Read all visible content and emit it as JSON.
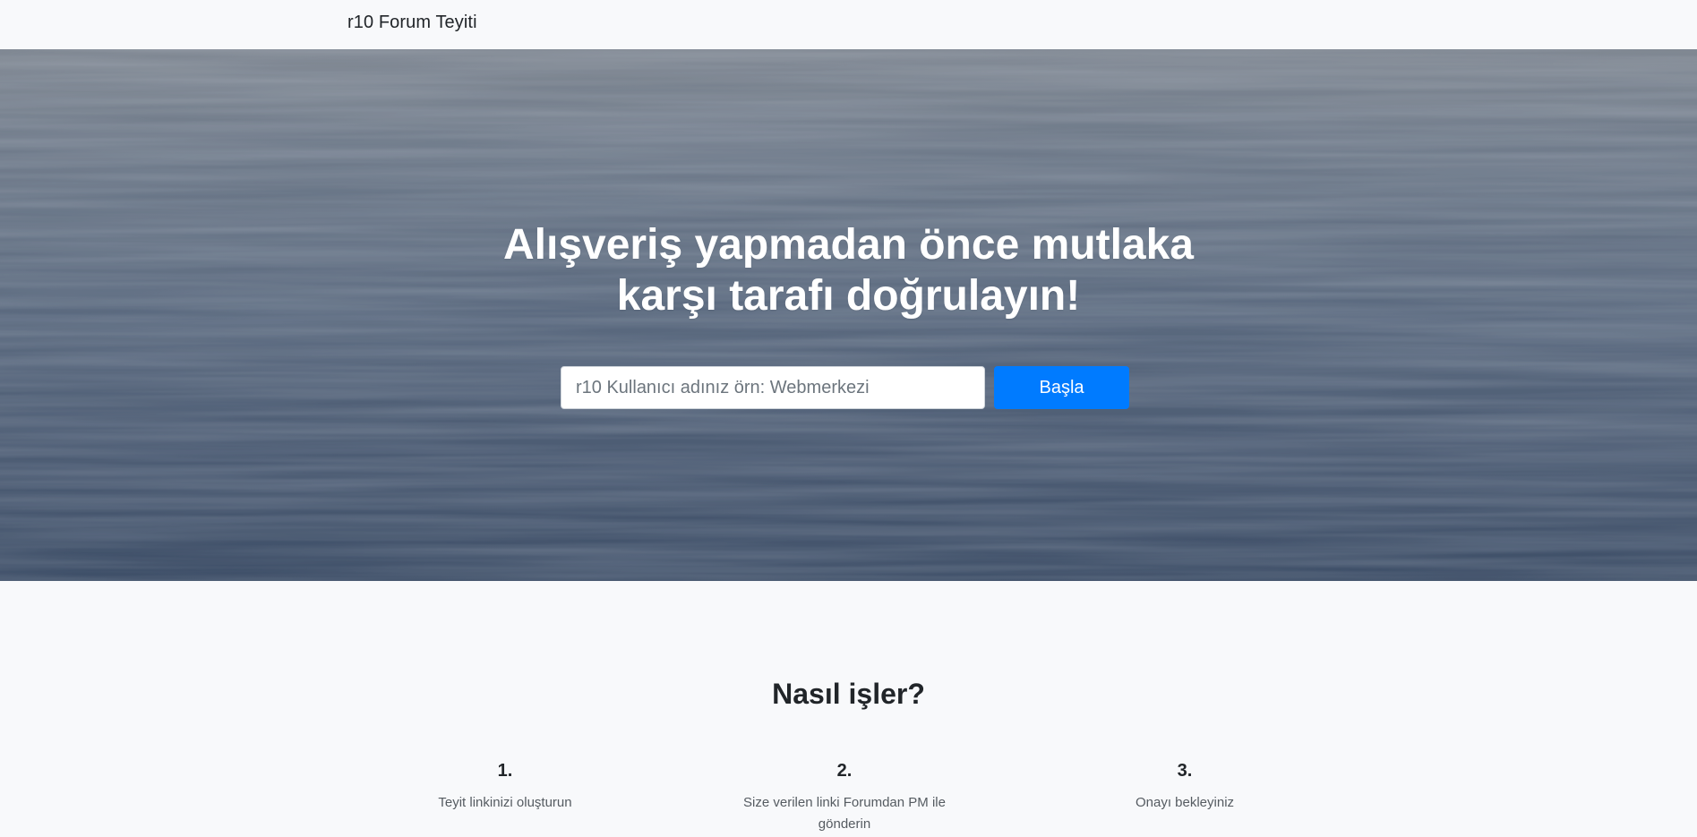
{
  "navbar": {
    "brand": "r10 Forum Teyiti"
  },
  "hero": {
    "headline_line1": "Alışveriş yapmadan önce mutlaka",
    "headline_line2": "karşı tarafı doğrulayın!",
    "search": {
      "placeholder": "r10 Kullanıcı adınız örn: Webmerkezi",
      "value": ""
    },
    "start_label": "Başla"
  },
  "how_it_works": {
    "title": "Nasıl işler?",
    "steps": [
      {
        "number": "1.",
        "text": "Teyit linkinizi oluşturun"
      },
      {
        "number": "2.",
        "text": "Size verilen linki Forumdan PM ile gönderin"
      },
      {
        "number": "3.",
        "text": "Onayı bekleyiniz"
      }
    ]
  },
  "colors": {
    "accent": "#007bff",
    "page_background": "#f8f9fb",
    "hero_tint": "#5e7089"
  }
}
